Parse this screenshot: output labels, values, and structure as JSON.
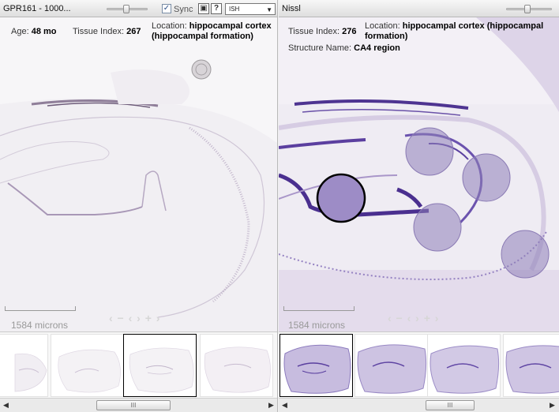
{
  "left": {
    "title": "GPR161 - 1000...",
    "sync_checked": "✓",
    "sync_label": "Sync",
    "save_icon_glyph": "▣",
    "help_icon_glyph": "?",
    "mode_select_value": "ISH",
    "meta": {
      "age_label": "Age:",
      "age_value": "48 mo",
      "tissue_label": "Tissue Index:",
      "tissue_value": "267",
      "location_label": "Location:",
      "location_value_line1": "hippocampal cortex",
      "location_value_line2": "(hippocampal formation)"
    },
    "scale_label": "1584 microns",
    "nav_arrows": "‹ − ‹ › + ›",
    "thumbnails_count": 4,
    "selected_thumbnail": 3,
    "scroll_grip": "III"
  },
  "right": {
    "title": "Nissl",
    "meta": {
      "tissue_label": "Tissue Index:",
      "tissue_value": "276",
      "location_label": "Location:",
      "location_value_line1": "hippocampal cortex (hippocampal",
      "location_value_line2": "formation)",
      "structure_label": "Structure Name:",
      "structure_value": "CA4 region"
    },
    "scale_label": "1584 microns",
    "nav_arrows": "‹ − ‹ › + ›",
    "selected_thumbnail": 1,
    "scroll_grip": "III"
  },
  "colors": {
    "ish_tissue": "#d9d3dd",
    "ish_stain": "#9a8aa6",
    "nissl_tissue": "#ece8f1",
    "nissl_stain": "#5a3f9a",
    "highlight_region": "#8e7fb8",
    "selected_region": "#9d8cc6"
  }
}
